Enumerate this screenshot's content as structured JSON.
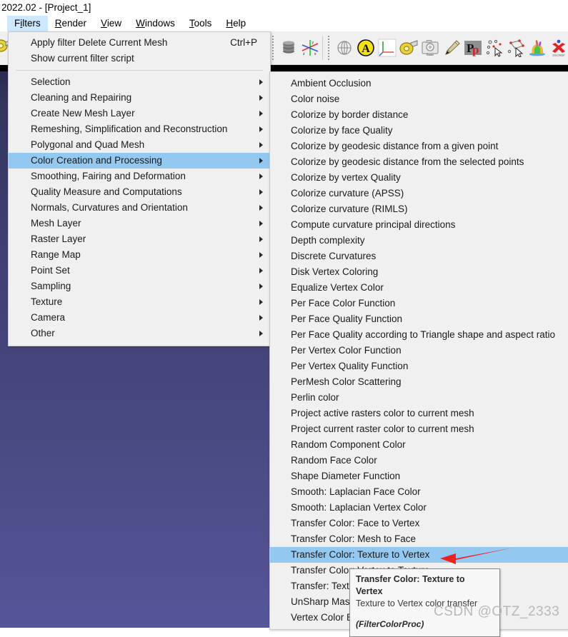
{
  "window": {
    "title": "2022.02 - [Project_1]"
  },
  "menubar": {
    "items": [
      {
        "name": "filters",
        "label": "Filters",
        "accel": "i",
        "active": true
      },
      {
        "name": "render",
        "label": "Render",
        "accel": "R",
        "active": false
      },
      {
        "name": "view",
        "label": "View",
        "accel": "V",
        "active": false
      },
      {
        "name": "windows",
        "label": "Windows",
        "accel": "W",
        "active": false
      },
      {
        "name": "tools",
        "label": "Tools",
        "accel": "T",
        "active": false
      },
      {
        "name": "help",
        "label": "Help",
        "accel": "H",
        "active": false
      }
    ]
  },
  "toolbar": {
    "buttons": [
      {
        "name": "layer-stack-icon",
        "title": "Show Layer Dialog"
      },
      {
        "name": "axis-tool-icon",
        "title": "Show Trackball / Axis"
      },
      {
        "name": "globe-wireframe-icon",
        "title": "Show Sphere"
      },
      {
        "name": "align-letter-a-icon",
        "title": "Align Tool"
      },
      {
        "name": "axis-origin-icon",
        "title": "Show Axis"
      },
      {
        "name": "measuring-tape-icon",
        "title": "Measuring Tool"
      },
      {
        "name": "camera-raster-align-icon",
        "title": "Raster Alignment"
      },
      {
        "name": "paintbrush-icon",
        "title": "Paint Tool"
      },
      {
        "name": "pp-points-icon",
        "title": "PickPoints"
      },
      {
        "name": "select-vertices-icon",
        "title": "Select Vertices"
      },
      {
        "name": "select-edges-icon",
        "title": "Select Connected Components"
      },
      {
        "name": "colored-bunny-icon",
        "title": "Quality Mapper"
      },
      {
        "name": "georef-icon",
        "title": "GeoRef"
      }
    ]
  },
  "filters_menu": {
    "rows": [
      {
        "name": "apply-filter-delete-current-mesh",
        "label": "Apply filter Delete Current Mesh",
        "shortcut": "Ctrl+P",
        "submenu": false,
        "selected": false
      },
      {
        "name": "show-current-filter-script",
        "label": "Show current filter script",
        "shortcut": "",
        "submenu": false,
        "selected": false
      },
      {
        "name": "separator",
        "label": "",
        "separator": true
      },
      {
        "name": "selection",
        "label": "Selection",
        "shortcut": "",
        "submenu": true,
        "selected": false
      },
      {
        "name": "cleaning-and-repairing",
        "label": "Cleaning and Repairing",
        "shortcut": "",
        "submenu": true,
        "selected": false
      },
      {
        "name": "create-new-mesh-layer",
        "label": "Create New Mesh Layer",
        "shortcut": "",
        "submenu": true,
        "selected": false
      },
      {
        "name": "remeshing-simplification-and-reconstruction",
        "label": "Remeshing, Simplification and Reconstruction",
        "shortcut": "",
        "submenu": true,
        "selected": false
      },
      {
        "name": "polygonal-and-quad-mesh",
        "label": "Polygonal and Quad Mesh",
        "shortcut": "",
        "submenu": true,
        "selected": false
      },
      {
        "name": "color-creation-and-processing",
        "label": "Color Creation and Processing",
        "shortcut": "",
        "submenu": true,
        "selected": true
      },
      {
        "name": "smoothing-fairing-and-deformation",
        "label": "Smoothing, Fairing and Deformation",
        "shortcut": "",
        "submenu": true,
        "selected": false
      },
      {
        "name": "quality-measure-and-computations",
        "label": "Quality Measure and Computations",
        "shortcut": "",
        "submenu": true,
        "selected": false
      },
      {
        "name": "normals-curvatures-and-orientation",
        "label": "Normals, Curvatures and Orientation",
        "shortcut": "",
        "submenu": true,
        "selected": false
      },
      {
        "name": "mesh-layer",
        "label": "Mesh Layer",
        "shortcut": "",
        "submenu": true,
        "selected": false
      },
      {
        "name": "raster-layer",
        "label": "Raster Layer",
        "shortcut": "",
        "submenu": true,
        "selected": false
      },
      {
        "name": "range-map",
        "label": "Range Map",
        "shortcut": "",
        "submenu": true,
        "selected": false
      },
      {
        "name": "point-set",
        "label": "Point Set",
        "shortcut": "",
        "submenu": true,
        "selected": false
      },
      {
        "name": "sampling",
        "label": "Sampling",
        "shortcut": "",
        "submenu": true,
        "selected": false
      },
      {
        "name": "texture",
        "label": "Texture",
        "shortcut": "",
        "submenu": true,
        "selected": false
      },
      {
        "name": "camera",
        "label": "Camera",
        "shortcut": "",
        "submenu": true,
        "selected": false
      },
      {
        "name": "other",
        "label": "Other",
        "shortcut": "",
        "submenu": true,
        "selected": false
      }
    ]
  },
  "color_submenu": {
    "rows": [
      {
        "name": "ambient-occlusion",
        "label": "Ambient Occlusion",
        "selected": false
      },
      {
        "name": "color-noise",
        "label": "Color noise",
        "selected": false
      },
      {
        "name": "colorize-by-border-distance",
        "label": "Colorize by border distance",
        "selected": false
      },
      {
        "name": "colorize-by-face-quality",
        "label": "Colorize by face Quality",
        "selected": false
      },
      {
        "name": "colorize-by-geodesic-distance-from-a-given-point",
        "label": "Colorize by geodesic distance from a given point",
        "selected": false
      },
      {
        "name": "colorize-by-geodesic-distance-from-the-selected-points",
        "label": "Colorize by geodesic distance from the selected points",
        "selected": false
      },
      {
        "name": "colorize-by-vertex-quality",
        "label": "Colorize by vertex Quality",
        "selected": false
      },
      {
        "name": "colorize-curvature-apss",
        "label": "Colorize curvature (APSS)",
        "selected": false
      },
      {
        "name": "colorize-curvature-rimls",
        "label": "Colorize curvature (RIMLS)",
        "selected": false
      },
      {
        "name": "compute-curvature-principal-directions",
        "label": "Compute curvature principal directions",
        "selected": false
      },
      {
        "name": "depth-complexity",
        "label": "Depth complexity",
        "selected": false
      },
      {
        "name": "discrete-curvatures",
        "label": "Discrete Curvatures",
        "selected": false
      },
      {
        "name": "disk-vertex-coloring",
        "label": "Disk Vertex Coloring",
        "selected": false
      },
      {
        "name": "equalize-vertex-color",
        "label": "Equalize Vertex Color",
        "selected": false
      },
      {
        "name": "per-face-color-function",
        "label": "Per Face Color Function",
        "selected": false
      },
      {
        "name": "per-face-quality-function",
        "label": "Per Face Quality Function",
        "selected": false
      },
      {
        "name": "per-face-quality-according-to-triangle-shape-and-aspect-ratio",
        "label": "Per Face Quality according to Triangle shape and aspect ratio",
        "selected": false
      },
      {
        "name": "per-vertex-color-function",
        "label": "Per Vertex Color Function",
        "selected": false
      },
      {
        "name": "per-vertex-quality-function",
        "label": "Per Vertex Quality Function",
        "selected": false
      },
      {
        "name": "permesh-color-scattering",
        "label": "PerMesh Color Scattering",
        "selected": false
      },
      {
        "name": "perlin-color",
        "label": "Perlin color",
        "selected": false
      },
      {
        "name": "project-active-rasters-color-to-current-mesh",
        "label": "Project active rasters color to current mesh",
        "selected": false
      },
      {
        "name": "project-current-raster-color-to-current-mesh",
        "label": "Project current raster color to current mesh",
        "selected": false
      },
      {
        "name": "random-component-color",
        "label": "Random Component Color",
        "selected": false
      },
      {
        "name": "random-face-color",
        "label": "Random Face Color",
        "selected": false
      },
      {
        "name": "shape-diameter-function",
        "label": "Shape Diameter Function",
        "selected": false
      },
      {
        "name": "smooth-laplacian-face-color",
        "label": "Smooth: Laplacian Face Color",
        "selected": false
      },
      {
        "name": "smooth-laplacian-vertex-color",
        "label": "Smooth: Laplacian Vertex Color",
        "selected": false
      },
      {
        "name": "transfer-color-face-to-vertex",
        "label": "Transfer Color: Face to Vertex",
        "selected": false
      },
      {
        "name": "transfer-color-mesh-to-face",
        "label": "Transfer Color: Mesh to Face",
        "selected": false
      },
      {
        "name": "transfer-color-texture-to-vertex",
        "label": "Transfer Color: Texture to Vertex",
        "selected": true
      },
      {
        "name": "transfer-color-vertex-to-texture",
        "label": "Transfer Color: Vertex to Texture",
        "selected": false
      },
      {
        "name": "transfer-texture-to-color-per-vertex",
        "label": "Transfer: Texture to Color Per Vertex",
        "selected": false
      },
      {
        "name": "unsharp-mask-color",
        "label": "UnSharp Mask Color",
        "selected": false
      },
      {
        "name": "vertex-color-brightness-contrast-gamma",
        "label": "Vertex Color Brightness Contrast Gamma",
        "selected": false
      }
    ]
  },
  "tooltip": {
    "title": "Transfer Color: Texture to Vertex",
    "description": "Texture to Vertex color transfer",
    "class_name": "(FilterColorProc)"
  },
  "annotation": {
    "arrow_color": "#ef2020"
  },
  "watermark": {
    "text": "CSDN @OTZ_2333"
  },
  "colors": {
    "menu_background": "#f0f0f0",
    "menu_highlight": "#93c9f0",
    "menubar_active": "#cde8ff",
    "viewport_top": "#2c2c52",
    "viewport_bottom": "#55559a"
  }
}
